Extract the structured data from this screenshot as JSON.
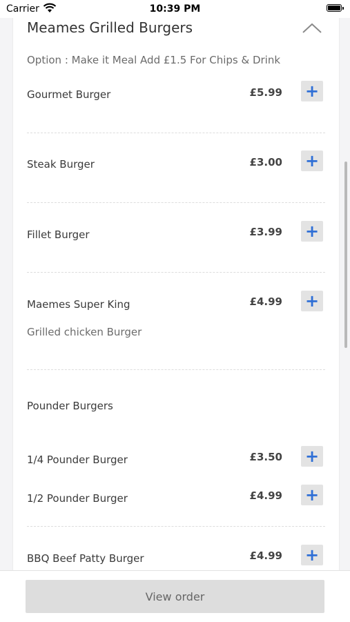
{
  "status_bar": {
    "carrier": "Carrier",
    "time": "10:39 PM",
    "wifi_icon": "wifi-icon",
    "battery_icon": "battery-icon"
  },
  "menu": {
    "section_title": "Meames Grilled Burgers",
    "collapse_icon": "chevron-up-icon",
    "option_text": "Option : Make it Meal Add £1.5 For Chips & Drink",
    "add_icon": "plus-icon",
    "items": [
      {
        "name": "Gourmet Burger",
        "price": "£5.99"
      },
      {
        "name": "Steak Burger",
        "price": "£3.00"
      },
      {
        "name": "Fillet Burger",
        "price": "£3.99"
      },
      {
        "name": "Maemes Super King",
        "price": "£4.99",
        "description": "Grilled chicken Burger"
      }
    ],
    "group_heading": "Pounder Burgers",
    "pounder_items": [
      {
        "name": "1/4 Pounder Burger",
        "price": "£3.50"
      },
      {
        "name": "1/2 Pounder Burger",
        "price": "£4.99"
      }
    ],
    "bbq_item": {
      "name": "BBQ Beef Patty Burger",
      "price": "£4.99"
    }
  },
  "footer": {
    "view_order_label": "View order"
  },
  "colors": {
    "accent": "#2f6fd6",
    "button_bg": "#e3e3e3",
    "background": "#f4f4f6"
  }
}
